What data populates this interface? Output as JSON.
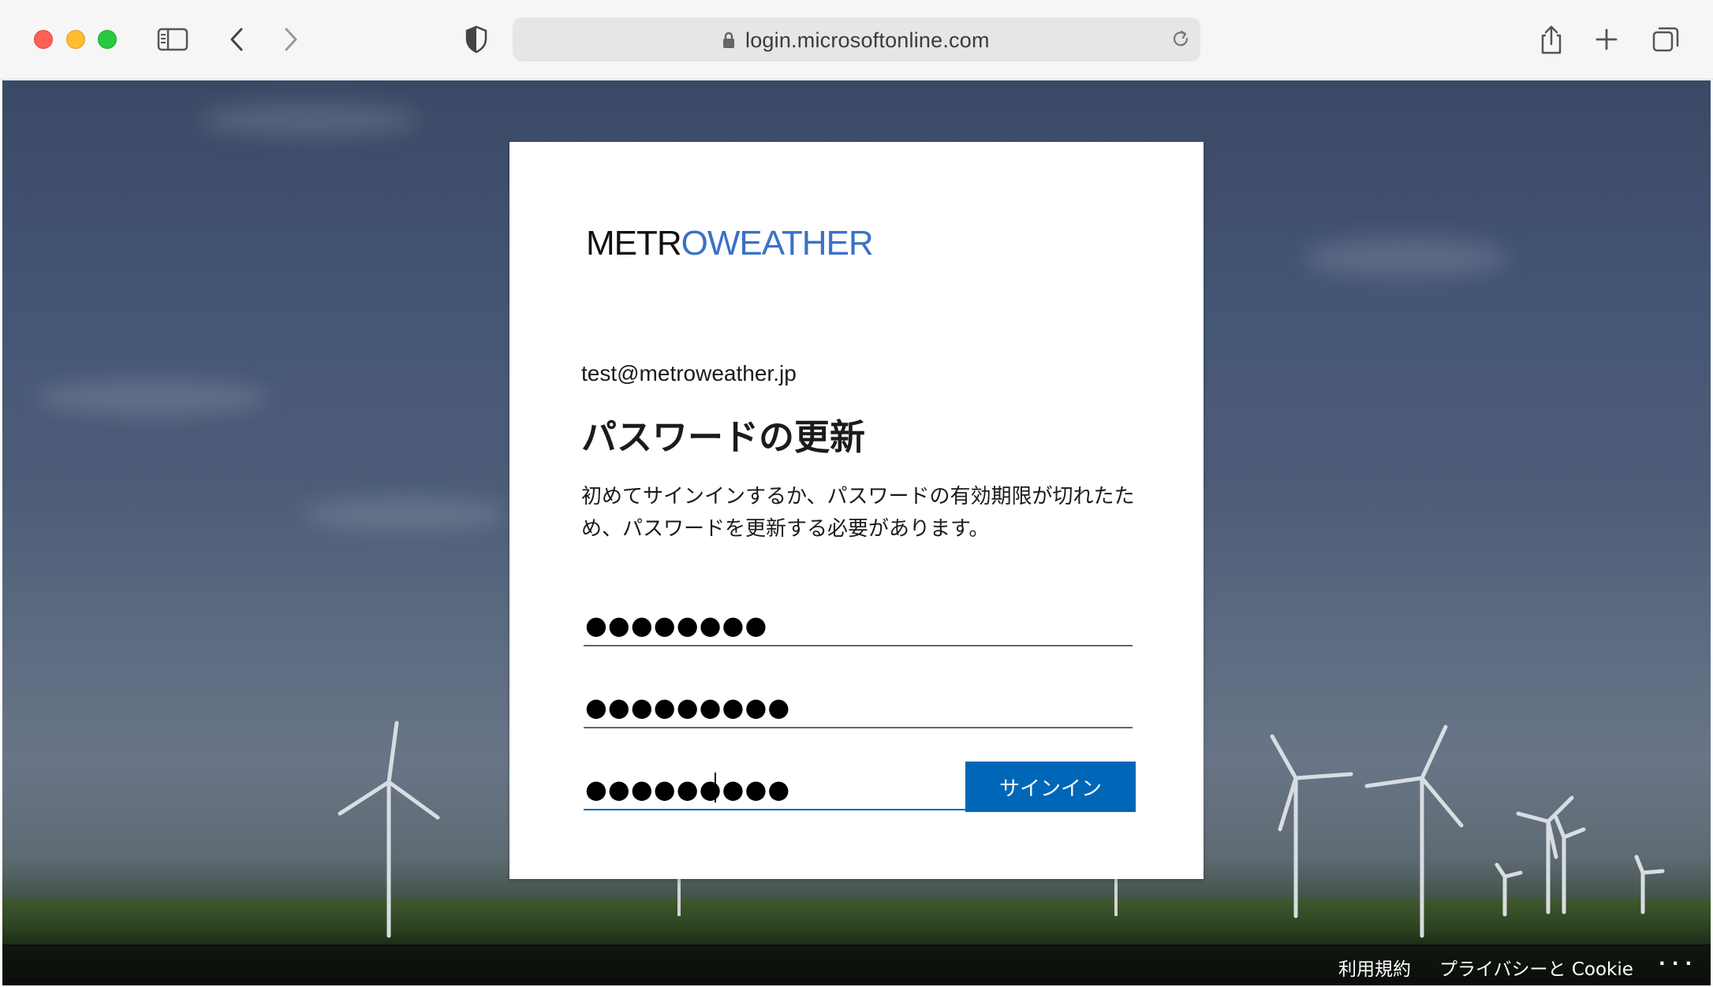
{
  "browser": {
    "url": "login.microsoftonline.com"
  },
  "card": {
    "logo_text_metro": "METR",
    "logo_text_o": "O",
    "logo_text_weather": "WEATHER",
    "identity": "test@metroweather.jp",
    "title": "パスワードの更新",
    "description": "初めてサインインするか、パスワードの有効期限が切れたため、パスワードを更新する必要があります。",
    "fields": [
      {
        "value": "●●●●●●●●",
        "focused": false
      },
      {
        "value": "●●●●●●●●●",
        "focused": false
      },
      {
        "value": "●●●●●●●●●",
        "focused": true
      }
    ],
    "signin_label": "サインイン"
  },
  "footer": {
    "terms": "利用規約",
    "privacy": "プライバシーと Cookie",
    "more": ". . ."
  },
  "colors": {
    "accent": "#0067b8",
    "logo_blue": "#3a72c4"
  }
}
